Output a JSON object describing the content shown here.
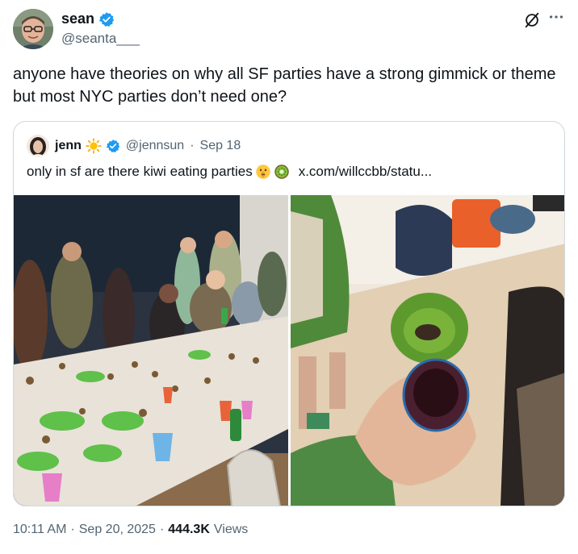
{
  "author": {
    "display_name": "sean",
    "handle": "@seanta___",
    "verified": true
  },
  "tweet": {
    "text": "anyone have theories on why all SF parties have a strong gimmick or theme but most NYC parties don’t need one?"
  },
  "quote": {
    "display_name": "jenn",
    "handle": "@jennsun",
    "separator": "·",
    "date": "Sep 18",
    "text": "only in sf are there kiwi eating parties",
    "link": "x.com/willccbb/statu..."
  },
  "meta": {
    "time": "10:11 AM",
    "separator": "·",
    "date": "Sep 20, 2025",
    "views_count": "444.3K",
    "views_label": "Views"
  },
  "icons": {
    "verified": "verified-badge-icon",
    "grok": "grok-icon",
    "more": "more-icon",
    "sun": "sun-emoji",
    "shush": "shushing-face-emoji",
    "kiwi": "kiwi-emoji"
  },
  "colors": {
    "verified_blue": "#1d9bf0",
    "secondary_text": "#536471",
    "border": "#cfd9de"
  }
}
